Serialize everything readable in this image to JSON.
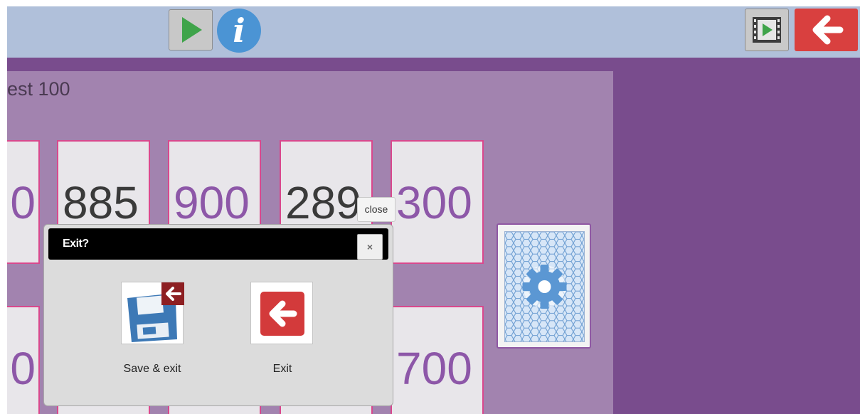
{
  "board": {
    "title": "est 100"
  },
  "cards_top": [
    {
      "value": "0",
      "color": "purple"
    },
    {
      "value": "885",
      "color": "dark"
    },
    {
      "value": "900",
      "color": "purple"
    },
    {
      "value": "289",
      "color": "dark"
    },
    {
      "value": "300",
      "color": "purple"
    }
  ],
  "cards_bottom": [
    {
      "value": "0",
      "color": "purple"
    },
    {
      "value": "700",
      "color": "purple"
    }
  ],
  "toolbar": {
    "play_icon": "play-icon",
    "info_icon": "info-icon",
    "info_glyph": "i",
    "video_icon": "video-icon",
    "back_icon": "back-arrow-icon"
  },
  "tooltip": {
    "text": "close"
  },
  "dialog": {
    "title": "Exit?",
    "close_glyph": "×",
    "options": [
      {
        "label": "Save & exit",
        "icon": "save-exit-icon"
      },
      {
        "label": "Exit",
        "icon": "exit-icon"
      }
    ]
  },
  "colors": {
    "topbar": "#b0c0da",
    "purple": "#794c8d",
    "board": "#a283af",
    "card_border": "#d9488d",
    "number_purple": "#8d57a8",
    "number_dark": "#3a3a3a",
    "exit_red": "#d9403f"
  }
}
